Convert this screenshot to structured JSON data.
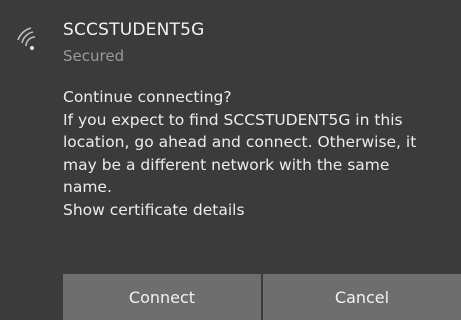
{
  "network": {
    "name": "SCCSTUDENT5G",
    "status": "Secured",
    "icon": "wifi-secured-icon"
  },
  "message": {
    "heading": "Continue connecting?",
    "lines": [
      "If you expect to find SCCSTUDENT5G in this",
      "location, go ahead and connect. Otherwise, it",
      "may be a different network with the same",
      "name."
    ],
    "link": "Show certificate details"
  },
  "buttons": {
    "connect": "Connect",
    "cancel": "Cancel"
  },
  "colors": {
    "background": "#3b3b3b",
    "button": "#6e6e6e",
    "text": "#ececec",
    "secondary_text": "#9a9a9a"
  }
}
